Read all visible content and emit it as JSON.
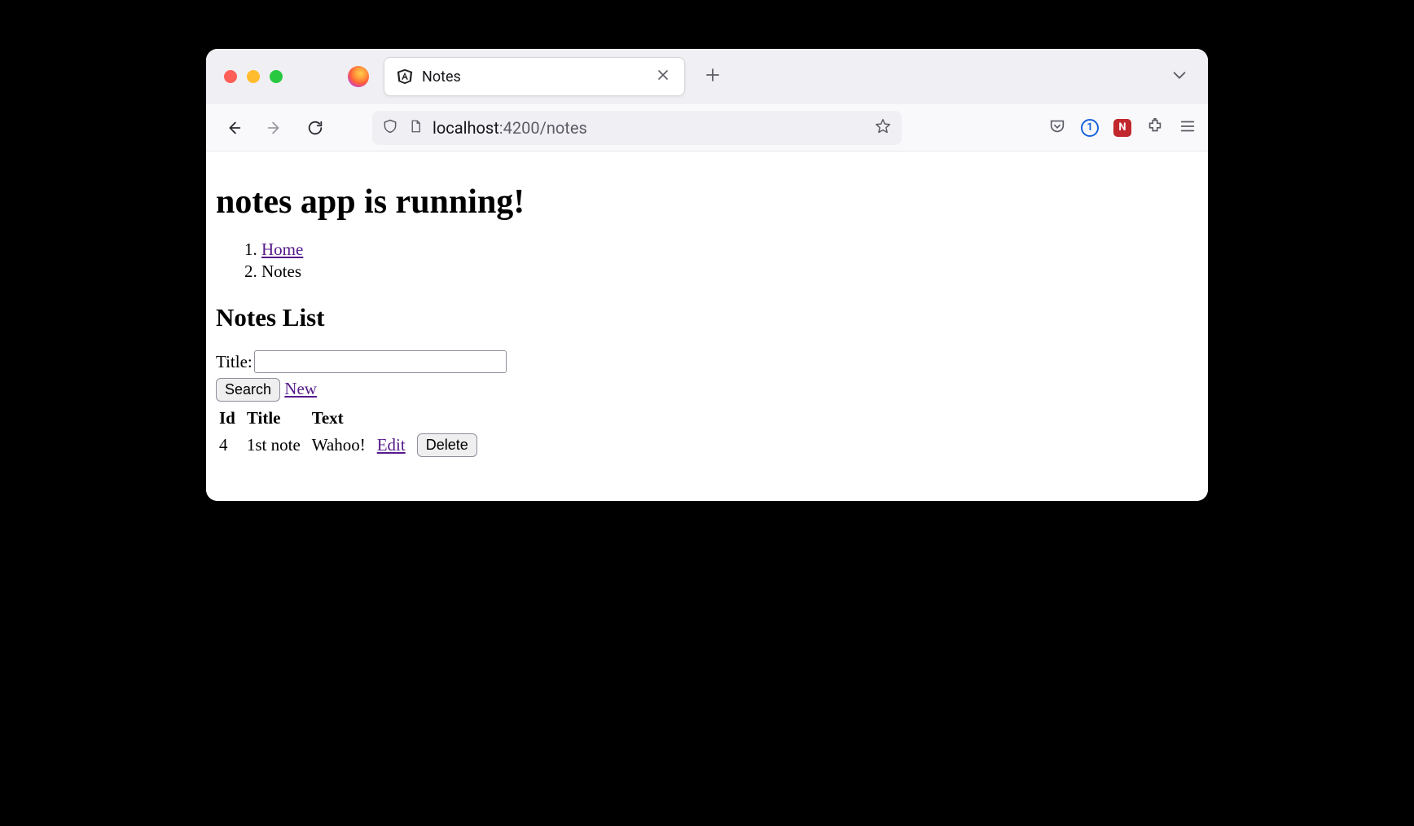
{
  "browser": {
    "tab_title": "Notes",
    "url_host": "localhost",
    "url_path": ":4200/notes"
  },
  "page": {
    "heading": "notes app is running!",
    "breadcrumb": {
      "home": "Home",
      "notes": "Notes"
    },
    "subheading": "Notes List",
    "form": {
      "title_label": "Title:",
      "title_value": "",
      "search_button": "Search",
      "new_link": "New"
    },
    "table": {
      "headers": {
        "id": "Id",
        "title": "Title",
        "text": "Text"
      },
      "rows": [
        {
          "id": "4",
          "title": "1st note",
          "text": "Wahoo!",
          "edit": "Edit",
          "delete": "Delete"
        }
      ]
    }
  }
}
